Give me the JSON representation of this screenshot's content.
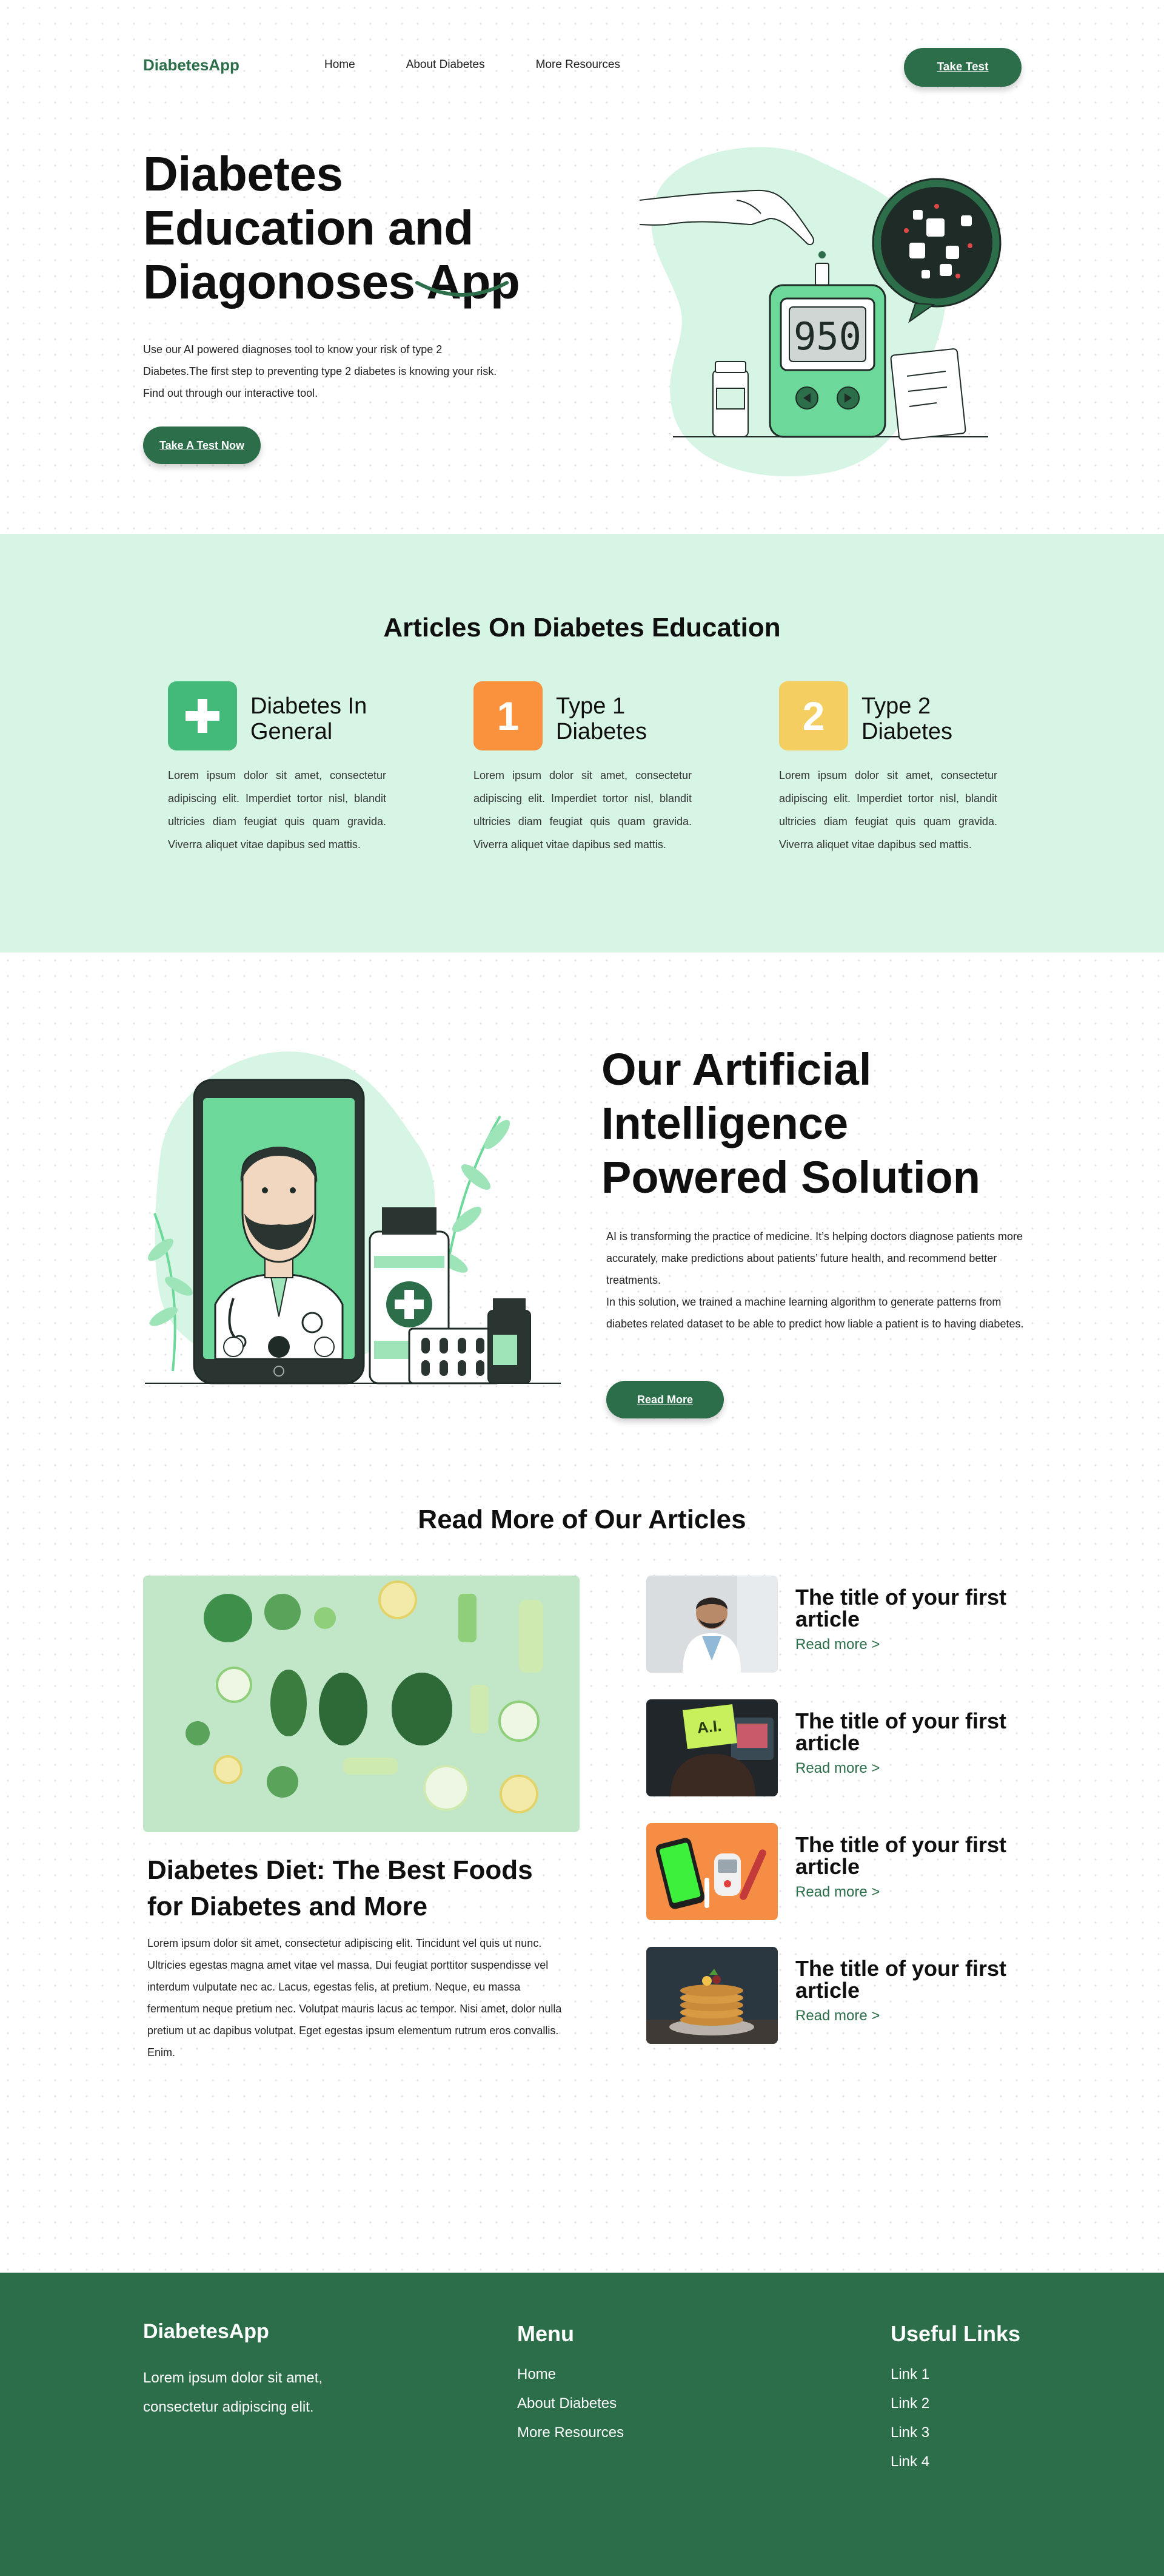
{
  "nav": {
    "logo": "DiabetesApp",
    "links": [
      "Home",
      "About Diabetes",
      "More Resources"
    ],
    "cta": "Take Test"
  },
  "hero": {
    "title_line1": "Diabetes",
    "title_line2": "Education and",
    "title_line3": "Diagonoses App",
    "description": "Use our AI powered diagnoses tool to know your risk of type 2 Diabetes.The first step to preventing type 2 diabetes is knowing your risk. Find out through our interactive tool.",
    "cta": "Take A Test Now",
    "meter_reading": "950"
  },
  "education": {
    "title": "Articles On Diabetes Education",
    "cards": [
      {
        "icon": "plus-icon",
        "icon_text": "",
        "color": "#44ba7a",
        "title": "Diabetes In General",
        "text": "Lorem ipsum dolor sit amet, consectetur adipiscing elit. Imperdiet tortor nisl, blandit ultricies diam feugiat quis quam gravida. Viverra aliquet vitae dapibus sed mattis."
      },
      {
        "icon": "number-one-icon",
        "icon_text": "1",
        "color": "#f9913d",
        "title": "Type 1 Diabetes",
        "text": "Lorem ipsum dolor sit amet, consectetur adipiscing elit. Imperdiet tortor nisl, blandit ultricies diam feugiat quis quam gravida. Viverra aliquet vitae dapibus sed mattis."
      },
      {
        "icon": "number-two-icon",
        "icon_text": "2",
        "color": "#f5ce62",
        "title": "Type 2 Diabetes",
        "text": "Lorem ipsum dolor sit amet, consectetur adipiscing elit. Imperdiet tortor nisl, blandit ultricies diam feugiat quis quam gravida. Viverra aliquet vitae dapibus sed mattis."
      }
    ]
  },
  "ai": {
    "title_line1": "Our Artificial",
    "title_line2": "Intelligence",
    "title_line3": "Powered Solution",
    "paragraph1": "AI is transforming the practice of medicine. It’s helping doctors diagnose patients more accurately, make predictions about patients’ future health, and recommend better treatments.",
    "paragraph2": "In this solution, we trained a machine learning algorithm to generate patterns from diabetes related dataset to be able to predict how liable a patient is to having diabetes.",
    "cta": "Read More"
  },
  "more": {
    "title": "Read More of Our Articles",
    "feature": {
      "title": "Diabetes Diet: The Best Foods for Diabetes and More",
      "text": "Lorem ipsum dolor sit amet, consectetur adipiscing elit. Tincidunt vel quis ut nunc. Ultricies egestas magna amet vitae vel massa. Dui feugiat porttitor suspendisse vel interdum vulputate nec ac. Lacus, egestas felis, at pretium. Neque, eu massa fermentum neque pretium nec. Volutpat mauris lacus ac tempor. Nisi amet, dolor nulla pretium ut ac dapibus volutpat. Eget egestas ipsum elementum rutrum eros convallis. Enim."
    },
    "articles": [
      {
        "title": "The title of your first article",
        "link": "Read more >",
        "thumb": "doctor-photo"
      },
      {
        "title": "The title of your first article",
        "link": "Read more >",
        "thumb": "ai-sign-photo",
        "thumb_text": "A.I."
      },
      {
        "title": "The title of your first article",
        "link": "Read more >",
        "thumb": "glucose-devices-photo"
      },
      {
        "title": "The title of your first article",
        "link": "Read more >",
        "thumb": "pancakes-photo"
      }
    ]
  },
  "footer": {
    "logo": "DiabetesApp",
    "description": "Lorem ipsum dolor sit amet, consectetur adipiscing elit.",
    "menu_title": "Menu",
    "menu_links": [
      "Home",
      "About Diabetes",
      "More Resources"
    ],
    "useful_title": "Useful Links",
    "useful_links": [
      "Link 1",
      "Link 2",
      "Link 3",
      "Link 4"
    ]
  },
  "colors": {
    "primary": "#2b6e49",
    "mint": "#d6f5e4",
    "light_green": "#6cd89a",
    "orange": "#f9913d",
    "yellow": "#f5ce62"
  }
}
